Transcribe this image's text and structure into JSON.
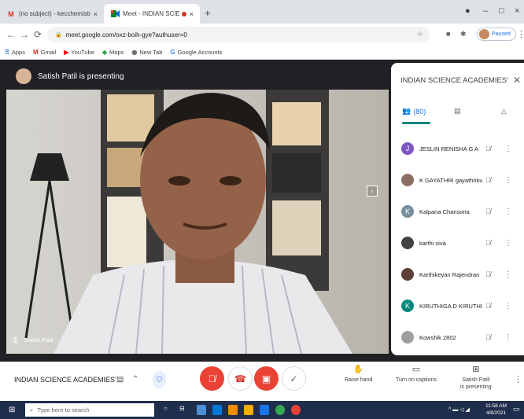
{
  "browser": {
    "tabs": [
      {
        "label": "(no subject) - kecchemistry@kon",
        "close": "×"
      },
      {
        "label": "Meet - INDIAN SCIENCE ACA",
        "close": "×"
      }
    ],
    "new_tab": "+",
    "window_controls": {
      "minimize": "–",
      "restore": "□",
      "close": "×"
    },
    "url": "meet.google.com/oxz-boih-gye?authuser=0",
    "profile_status": "Paused",
    "bookmarks": [
      {
        "label": "Apps",
        "icon": "apps-grid-icon"
      },
      {
        "label": "Gmail",
        "icon": "gmail-icon"
      },
      {
        "label": "YouTube",
        "icon": "youtube-icon"
      },
      {
        "label": "Maps",
        "icon": "maps-icon"
      },
      {
        "label": "New Tab",
        "icon": "chrome-icon"
      },
      {
        "label": "Google Accounts",
        "icon": "google-icon"
      }
    ]
  },
  "meet": {
    "presenter_banner": "Satish Patil is presenting",
    "video_name_tag": "Satish Patil",
    "panel": {
      "title": "INDIAN SCIENCE ACADEMIES' SP...",
      "people_count": "(80)",
      "participants": [
        {
          "name": "JESLIN RENISHA G A",
          "initial": "J",
          "color": "#7e57c2"
        },
        {
          "name": "K GAYATHRI gayathriku...",
          "initial": "",
          "color": "#8d6e63"
        },
        {
          "name": "Kalpana Chansoria",
          "initial": "K",
          "color": "#78909c"
        },
        {
          "name": "karthi siva",
          "initial": "",
          "color": "#424242"
        },
        {
          "name": "Karthikeyan Rajendran",
          "initial": "",
          "color": "#5d4037"
        },
        {
          "name": "KIRUTHIGA D KIRUTHIG...",
          "initial": "K",
          "color": "#00897b"
        },
        {
          "name": "Kowshik 2802",
          "initial": "",
          "color": "#9e9e9e"
        }
      ]
    },
    "bottom": {
      "meeting_name": "INDIAN SCIENCE ACADEMIES'...",
      "raise_hand": "Raise hand",
      "captions": "Turn on captions",
      "presenting_line1": "Satish Patil",
      "presenting_line2": "is presenting"
    }
  },
  "taskbar": {
    "search_placeholder": "Type here to search",
    "time": "11:58 AM",
    "date": "4/8/2021"
  },
  "colors": {
    "meet_background": "#202124",
    "end_call_red": "#ea4335",
    "accent_blue": "#1a73e8",
    "taskbar": "#1f2e4d"
  }
}
